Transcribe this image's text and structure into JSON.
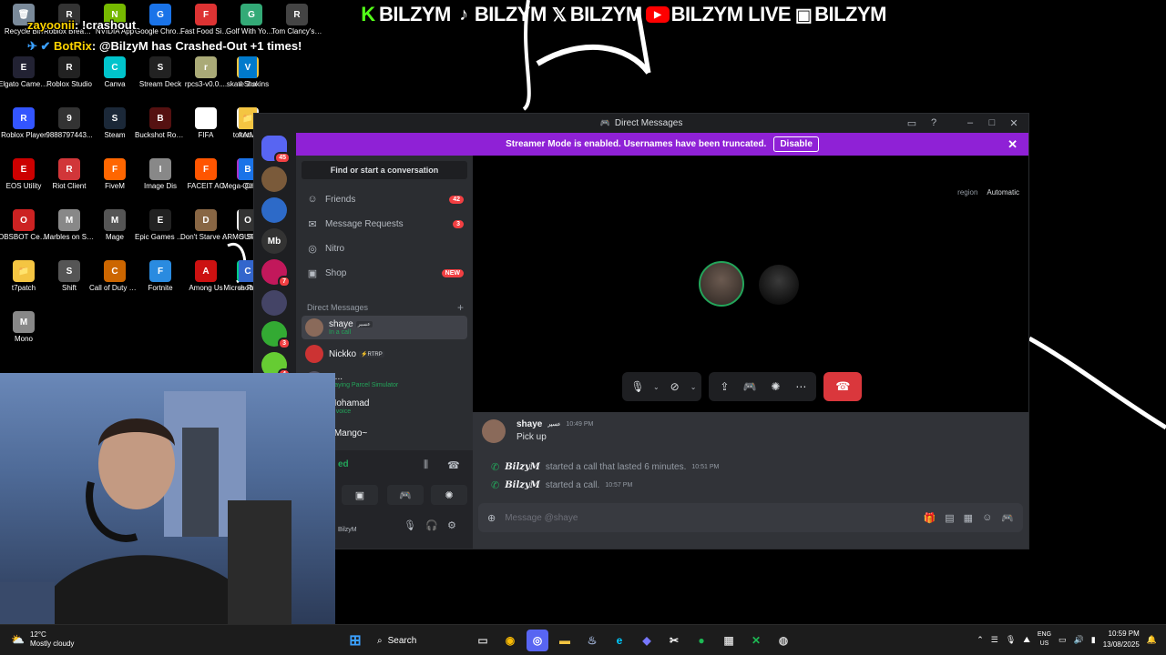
{
  "socials": [
    {
      "icon": "kick-icon",
      "glyph": "K",
      "name": "BILZYM"
    },
    {
      "icon": "tiktok-icon",
      "glyph": "♪",
      "name": "BILZYM"
    },
    {
      "icon": "x-icon",
      "glyph": "𝕏",
      "name": "BILZYM"
    },
    {
      "icon": "youtube-icon",
      "glyph": "▶",
      "name": "BILZYM LIVE"
    },
    {
      "icon": "roblox-icon",
      "glyph": "▣",
      "name": "BILZYM"
    }
  ],
  "chat": [
    {
      "user": "zayoonii",
      "msg": ": !crashout"
    },
    {
      "user": "BotRix",
      "msg": ": @BilzyM has Crashed-Out +1 times!"
    }
  ],
  "desktop": [
    {
      "label": "Recycle Bin",
      "color": "#7a8a9a",
      "glyph": "🗑"
    },
    {
      "label": "Roblox Breakou...",
      "color": "#333",
      "glyph": "R"
    },
    {
      "label": "NVIDIA App",
      "color": "#76b900",
      "glyph": "N"
    },
    {
      "label": "Google Chrome",
      "color": "#1a73e8",
      "glyph": "G"
    },
    {
      "label": "Fast Food Simulator",
      "color": "#d33",
      "glyph": "F"
    },
    {
      "label": "Golf With Your Friends",
      "color": "#3a7",
      "glyph": "G"
    },
    {
      "label": "Tom Clancy's Rainbow Si...",
      "color": "#444",
      "glyph": "R"
    },
    {
      "label": "Elgato Camera Hub",
      "color": "#223",
      "glyph": "E"
    },
    {
      "label": "Roblox Studio",
      "color": "#222",
      "glyph": "R"
    },
    {
      "label": "Canva",
      "color": "#00c4cc",
      "glyph": "C"
    },
    {
      "label": "Stream Deck",
      "color": "#222",
      "glyph": "S"
    },
    {
      "label": "rpcs3-v0.0....",
      "color": "#aa7",
      "glyph": "r"
    },
    {
      "label": "skate 3 skins",
      "color": "#f4c542",
      "glyph": "📁"
    },
    {
      "label": "Visual Studio Code",
      "color": "#007acc",
      "glyph": "V"
    },
    {
      "label": "Roblox Player",
      "color": "#3355ff",
      "glyph": "R"
    },
    {
      "label": "9888797443...",
      "color": "#333",
      "glyph": "9"
    },
    {
      "label": "Steam",
      "color": "#1b2838",
      "glyph": "S"
    },
    {
      "label": "Buckshot Roulette",
      "color": "#511",
      "glyph": "B"
    },
    {
      "label": "FIFA",
      "color": "#fff",
      "glyph": "F"
    },
    {
      "label": "token.ms",
      "color": "#eee",
      "glyph": "📄"
    },
    {
      "label": "ShiftAtMid...",
      "color": "#f4c542",
      "glyph": "📁"
    },
    {
      "label": "EOS Utility",
      "color": "#c00",
      "glyph": "E"
    },
    {
      "label": "Riot Client",
      "color": "#d13639",
      "glyph": "R"
    },
    {
      "label": "FiveM",
      "color": "#f60",
      "glyph": "F"
    },
    {
      "label": "Image Dis",
      "color": "#888",
      "glyph": "I"
    },
    {
      "label": "FACEIT AC",
      "color": "#f50",
      "glyph": "F"
    },
    {
      "label": "Mega Quiz Gaming",
      "color": "#a3c",
      "glyph": "M"
    },
    {
      "label": "Bilal - Chrome",
      "color": "#1a73e8",
      "glyph": "B"
    },
    {
      "label": "OBSBOT Center",
      "color": "#c22",
      "glyph": "O"
    },
    {
      "label": "Marbles on Stream",
      "color": "#888",
      "glyph": "M"
    },
    {
      "label": "Mage",
      "color": "#555",
      "glyph": "M"
    },
    {
      "label": "Epic Games Launcher",
      "color": "#222",
      "glyph": "E"
    },
    {
      "label": "Don't Starve Together",
      "color": "#864",
      "glyph": "D"
    },
    {
      "label": "ARMOURY CRATE - ...",
      "color": "#eee",
      "glyph": "📄"
    },
    {
      "label": "OBS Studio",
      "color": "#333",
      "glyph": "O"
    },
    {
      "label": "t7patch",
      "color": "#f4c542",
      "glyph": "📁"
    },
    {
      "label": "Shift",
      "color": "#555",
      "glyph": "S"
    },
    {
      "label": "Call of Duty Black Ops III",
      "color": "#c60",
      "glyph": "C"
    },
    {
      "label": "Fortnite",
      "color": "#2a8be0",
      "glyph": "F"
    },
    {
      "label": "Among Us",
      "color": "#c11",
      "glyph": "A"
    },
    {
      "label": "Microsoft Edge",
      "color": "#0c8",
      "glyph": "e"
    },
    {
      "label": "Clash Royale",
      "color": "#36c",
      "glyph": "C"
    },
    {
      "label": "Mono",
      "color": "#888",
      "glyph": "M"
    }
  ],
  "discord": {
    "title": "Direct Messages",
    "banner_text": "Streamer Mode is enabled. Usernames have been truncated.",
    "banner_button": "Disable",
    "find": "Find or start a conversation",
    "nav": [
      {
        "label": "Friends",
        "icon": "friends-icon",
        "glyph": "☺",
        "badge": "42"
      },
      {
        "label": "Message Requests",
        "icon": "mail-icon",
        "glyph": "✉",
        "badge": "3"
      },
      {
        "label": "Nitro",
        "icon": "nitro-icon",
        "glyph": "◎",
        "badge": ""
      },
      {
        "label": "Shop",
        "icon": "shop-icon",
        "glyph": "▣",
        "badge": "NEW"
      }
    ],
    "dm_header": "Direct Messages",
    "dms": [
      {
        "name": "shaye",
        "tag": "عسير",
        "sub": "In a call",
        "color": "#8a6a5a"
      },
      {
        "name": "Nickko",
        "tag": "⚡RTRP",
        "sub": "",
        "color": "#c33"
      },
      {
        "name": "S...",
        "tag": "",
        "sub": "Playing Parcel Simulator",
        "color": "#556"
      },
      {
        "name": "Mohamad",
        "tag": "",
        "sub": "In voice",
        "color": "#444"
      },
      {
        "name": "~Mango~",
        "tag": "",
        "sub": "",
        "color": "#b84"
      }
    ],
    "voice_status": "ed",
    "user_short": "BilzyM",
    "guild_badges": [
      "45",
      "",
      "",
      "",
      "7",
      "",
      "3",
      "4"
    ],
    "guild_label": "Mb",
    "region_label": "region",
    "region_value": "Automatic",
    "messages": {
      "author": "shaye",
      "author_tag": "عسير",
      "time": "10:49 PM",
      "text": "Pick up"
    },
    "system": [
      {
        "who": "BilzyM",
        "text": "started a call that lasted 6 minutes.",
        "time": "10:51 PM"
      },
      {
        "who": "BilzyM",
        "text": "started a call.",
        "time": "10:57 PM"
      }
    ],
    "composer_placeholder": "Message @shaye"
  },
  "taskbar": {
    "temp": "12°C",
    "weather": "Mostly cloudy",
    "search": "Search",
    "lang1": "ENG",
    "lang2": "US",
    "time": "10:59 PM",
    "date": "13/08/2025"
  }
}
